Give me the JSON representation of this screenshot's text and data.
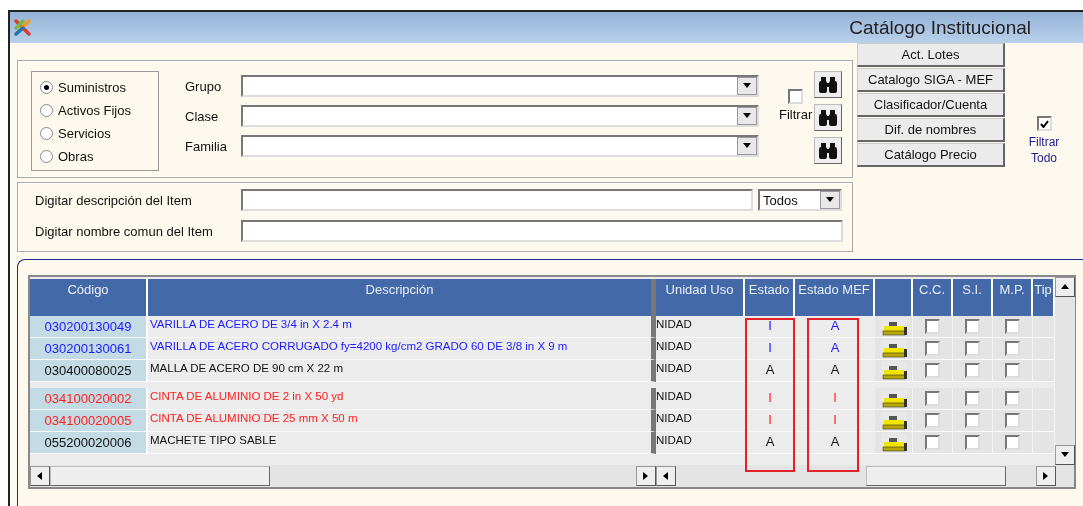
{
  "window": {
    "title": "Catálogo Institucional"
  },
  "item_types": [
    {
      "label": "Suministros",
      "selected": true
    },
    {
      "label": "Activos Fijos",
      "selected": false
    },
    {
      "label": "Servicios",
      "selected": false
    },
    {
      "label": "Obras",
      "selected": false
    }
  ],
  "filters": [
    {
      "label": "Grupo"
    },
    {
      "label": "Clase"
    },
    {
      "label": "Familia"
    }
  ],
  "filtrar": {
    "label": "Filtrar",
    "checked": false
  },
  "buttons": [
    "Act. Lotes",
    "Catalogo SIGA - MEF",
    "Clasificador/Cuenta",
    "Dif. de nombres",
    "Catálogo Precio"
  ],
  "filtrar_todo": {
    "label": "Filtrar Todo",
    "checked": true
  },
  "search": {
    "description_label": "Digitar descripción del Item",
    "status_option": "Todos",
    "common_name_label": "Digitar nombre comun del Item"
  },
  "table": {
    "columns": [
      {
        "kind": "text",
        "label": "Código",
        "highlighted": false
      },
      {
        "kind": "text",
        "label": "Descripción",
        "highlighted": false
      },
      {
        "kind": "text",
        "label": "Unidad Uso",
        "highlighted": false
      },
      {
        "kind": "text",
        "label": "Estado",
        "highlighted": true
      },
      {
        "kind": "text",
        "label": "Estado MEF",
        "highlighted": true
      },
      {
        "kind": "icon",
        "highlighted": false
      },
      {
        "kind": "text",
        "label": "C.C.",
        "highlighted": false
      },
      {
        "kind": "text",
        "label": "S.I.",
        "highlighted": false
      },
      {
        "kind": "text",
        "label": "M.P.",
        "highlighted": false
      },
      {
        "kind": "text",
        "label": "Tip",
        "highlighted": false
      }
    ],
    "rows": [
      {
        "code": "030200130049",
        "description": "VARILLA DE ACERO DE 3/4 in X 2.4 m",
        "unit": "NIDAD",
        "estado": "I",
        "estado_mef": "A",
        "color": "#1a1aff",
        "cc": false,
        "si": false,
        "mp": false
      },
      {
        "code": "030200130061",
        "description": "VARILLA DE ACERO CORRUGADO fy=4200 kg/cm2 GRADO 60 DE 3/8 in X 9 m",
        "unit": "NIDAD",
        "estado": "I",
        "estado_mef": "A",
        "color": "#1a1aff",
        "cc": false,
        "si": false,
        "mp": false
      },
      {
        "code": "030400080025",
        "description": "MALLA DE ACERO DE 90 cm X 22 m",
        "unit": "NIDAD",
        "estado": "A",
        "estado_mef": "A",
        "color": "#111111",
        "cc": false,
        "si": false,
        "mp": false
      },
      {
        "code": "034100020002",
        "description": "CINTA DE ALUMINIO DE 2 in X  50 yd",
        "unit": "NIDAD",
        "estado": "I",
        "estado_mef": "I",
        "color": "#ff2020",
        "cc": false,
        "si": false,
        "mp": false
      },
      {
        "code": "034100020005",
        "description": "CINTA DE ALUMINIO DE 25 mm X 50 m",
        "unit": "NIDAD",
        "estado": "I",
        "estado_mef": "I",
        "color": "#ff2020",
        "cc": false,
        "si": false,
        "mp": false
      },
      {
        "code": "055200020006",
        "description": "MACHETE TIPO SABLE",
        "unit": "NIDAD",
        "estado": "A",
        "estado_mef": "A",
        "color": "#111111",
        "cc": false,
        "si": false,
        "mp": false
      }
    ]
  }
}
